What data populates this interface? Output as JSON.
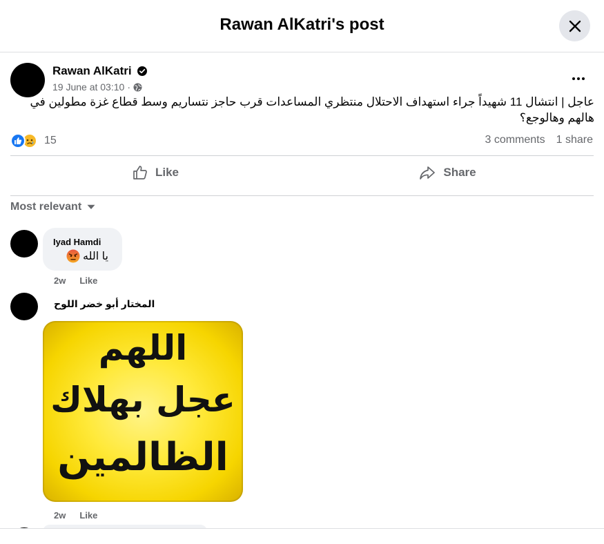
{
  "dialog": {
    "title": "Rawan AlKatri's post",
    "close_icon": "close-icon"
  },
  "post": {
    "author": "Rawan AlKatri",
    "verified_icon": "verified-badge-icon",
    "timestamp": "19 June at 03:10",
    "separator": "·",
    "audience_icon": "globe-icon",
    "text": "عاجل | انتشال 11 شهيداً جراء استهداف الاحتلال منتظري المساعدات قرب حاجز نتساريم وسط قطاع غزة مطولين في هالهم وهالوجع؟",
    "reactions": {
      "icons": [
        "like-reaction-icon",
        "sad-reaction-icon"
      ],
      "count": "15"
    },
    "comments_count": "3 comments",
    "shares_count": "1 share"
  },
  "actions": {
    "like_label": "Like",
    "share_label": "Share"
  },
  "comments_section": {
    "sort_label": "Most relevant"
  },
  "comments": [
    {
      "author": "Iyad Hamdi",
      "text": "يا الله",
      "emoji": "😡",
      "time": "2w",
      "like_label": "Like"
    },
    {
      "author": "المختار أبو خضر اللوح",
      "image_lines": [
        "اللهم",
        "عجل بهلاك",
        "الظالمين"
      ],
      "time": "2w",
      "like_label": "Like"
    }
  ],
  "colors": {
    "accent": "#1877f2",
    "secondary_text": "#65676b",
    "bubble": "#f0f2f5"
  }
}
